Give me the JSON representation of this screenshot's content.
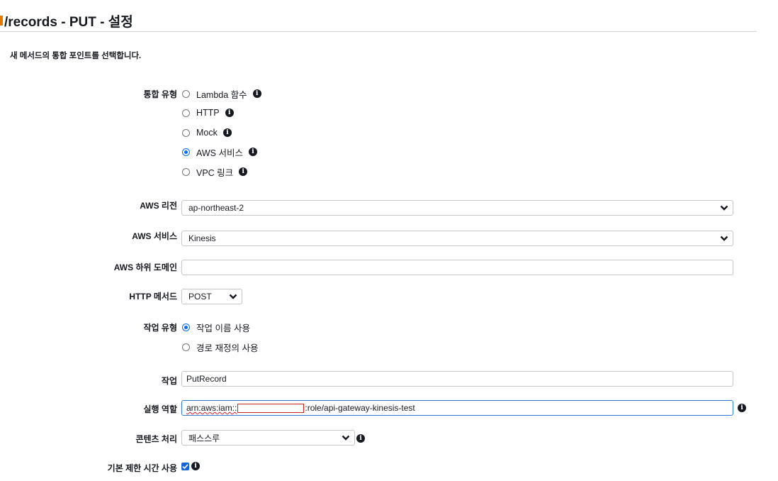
{
  "header": {
    "title": "/records - PUT - 설정",
    "subtitle": "새 메서드의 통합 포인트를 선택합니다."
  },
  "integration_type": {
    "label": "통합 유형",
    "options": [
      "Lambda 함수",
      "HTTP",
      "Mock",
      "AWS 서비스",
      "VPC 링크"
    ],
    "selected": "AWS 서비스"
  },
  "aws_region": {
    "label": "AWS 리전",
    "value": "ap-northeast-2"
  },
  "aws_service": {
    "label": "AWS 서비스",
    "value": "Kinesis"
  },
  "aws_subdomain": {
    "label": "AWS 하위 도메인",
    "value": ""
  },
  "http_method": {
    "label": "HTTP 메서드",
    "value": "POST"
  },
  "action_type": {
    "label": "작업 유형",
    "options": [
      "작업 이름 사용",
      "경로 재정의 사용"
    ],
    "selected": "작업 이름 사용"
  },
  "action": {
    "label": "작업",
    "value": "PutRecord"
  },
  "execution_role": {
    "label": "실행 역할",
    "prefix": "arn:aws:iam::",
    "suffix": ":role/api-gateway-kinesis-test"
  },
  "content_handling": {
    "label": "콘텐츠 처리",
    "value": "패스스루"
  },
  "default_timeout": {
    "label": "기본 제한 시간 사용",
    "checked": true
  },
  "colors": {
    "accent": "#e07b00",
    "radio_selected": "#0a6ee8",
    "focus_border": "#2f7bd6",
    "redaction": "#cc1f1f"
  }
}
